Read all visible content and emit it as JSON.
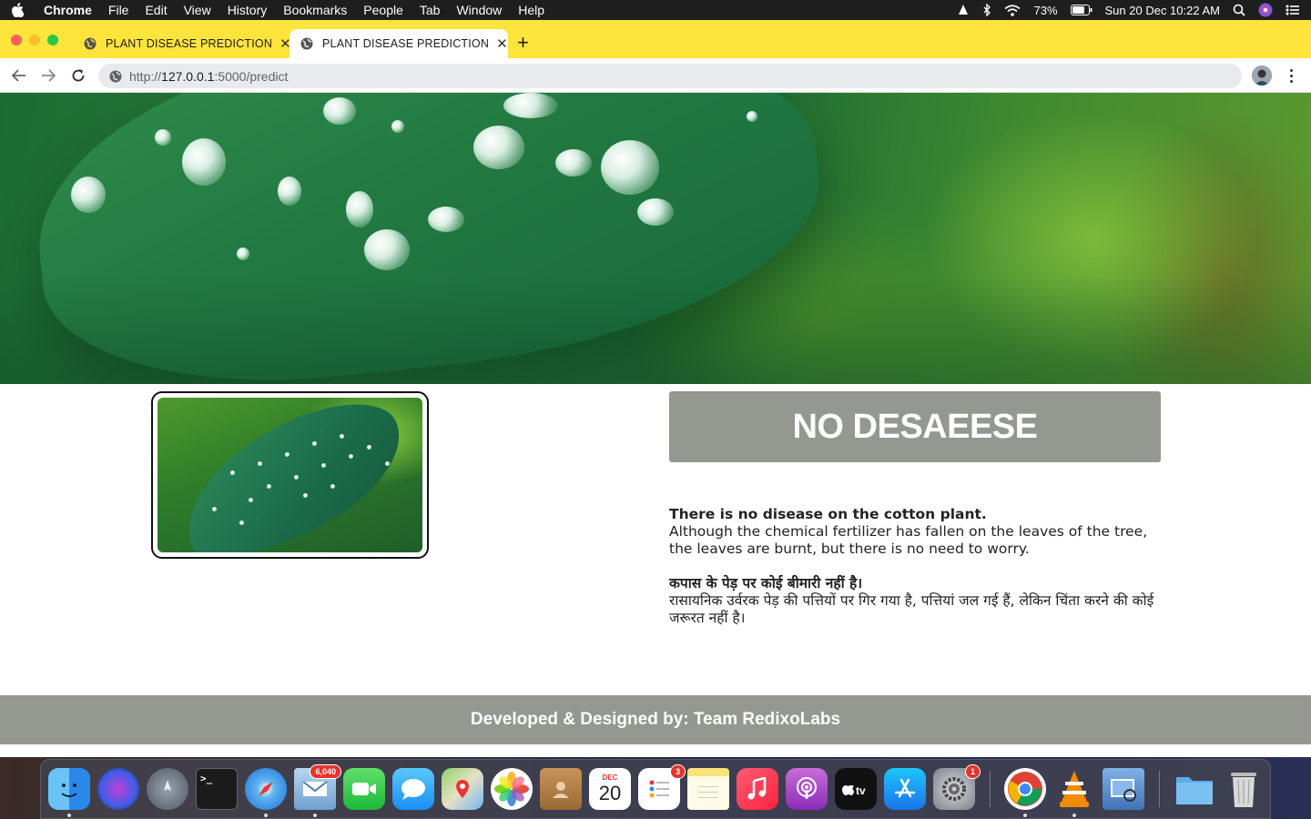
{
  "menubar": {
    "app_name": "Chrome",
    "items": [
      "File",
      "Edit",
      "View",
      "History",
      "Bookmarks",
      "People",
      "Tab",
      "Window",
      "Help"
    ],
    "battery": "73%",
    "datetime": "Sun 20 Dec  10:22 AM"
  },
  "tabs": [
    {
      "title": "PLANT DISEASE PREDICTION",
      "active": false
    },
    {
      "title": "PLANT DISEASE PREDICTION",
      "active": true
    }
  ],
  "toolbar": {
    "url_scheme": "http://",
    "url_host": "127.0.0.1",
    "url_rest": ":5000/predict"
  },
  "page": {
    "result_label": "NO DESAEESE",
    "english": {
      "heading": "There is no disease on the cotton plant.",
      "body": "Although the chemical fertilizer has fallen on the leaves of the tree, the leaves are burnt, but there is no need to worry."
    },
    "hindi": {
      "heading": "कपास के पेड़ पर कोई बीमारी नहीं है।",
      "body": "रासायनिक उर्वरक पेड़ की पत्तियों पर गिर गया है, पत्तियां जल गई हैं, लेकिन चिंता करने की कोई जरूरत नहीं है।"
    },
    "footer": "Developed & Designed by: Team RedixoLabs"
  },
  "dock": {
    "badges": {
      "mail": "6,040",
      "reminders": "3",
      "system_preferences": "1"
    },
    "calendar_month": "DEC",
    "calendar_day": "20",
    "apps": [
      "Finder",
      "Siri",
      "Launchpad",
      "Terminal",
      "Safari",
      "Mail",
      "FaceTime",
      "Messages",
      "Maps",
      "Photos",
      "Contacts",
      "Calendar",
      "Reminders",
      "Notes",
      "Music",
      "Podcasts",
      "TV",
      "App Store",
      "System Preferences",
      "Google Chrome",
      "VLC",
      "Preview",
      "Downloads",
      "Trash"
    ]
  }
}
